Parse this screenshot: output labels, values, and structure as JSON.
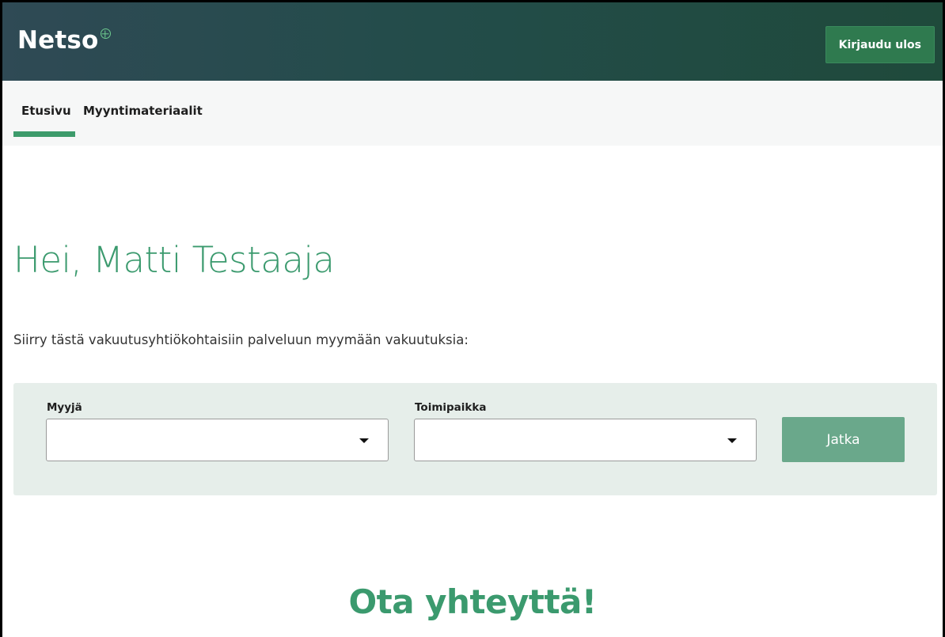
{
  "header": {
    "logo_text": "Netso",
    "logo_icon": "flower-mark-icon",
    "logout_label": "Kirjaudu ulos"
  },
  "nav": {
    "tabs": [
      {
        "label": "Etusivu",
        "active": true
      },
      {
        "label": "Myyntimateriaalit",
        "active": false
      }
    ]
  },
  "main": {
    "greeting": "Hei, Matti Testaaja",
    "intro": "Siirry tästä vakuutusyhtiökohtaisiin palveluun myymään vakuutuksia:",
    "form": {
      "seller_label": "Myyjä",
      "seller_value": "",
      "office_label": "Toimipaikka",
      "office_value": "",
      "continue_label": "Jatka"
    },
    "contact_heading": "Ota yhteyttä!"
  },
  "colors": {
    "header_bg_start": "#2f4a55",
    "header_bg_end": "#1f4a3b",
    "accent_green": "#3b9a6e",
    "button_green": "#2f7a4f",
    "continue_disabled": "#6aa88b",
    "panel_bg": "#e6eeea"
  }
}
